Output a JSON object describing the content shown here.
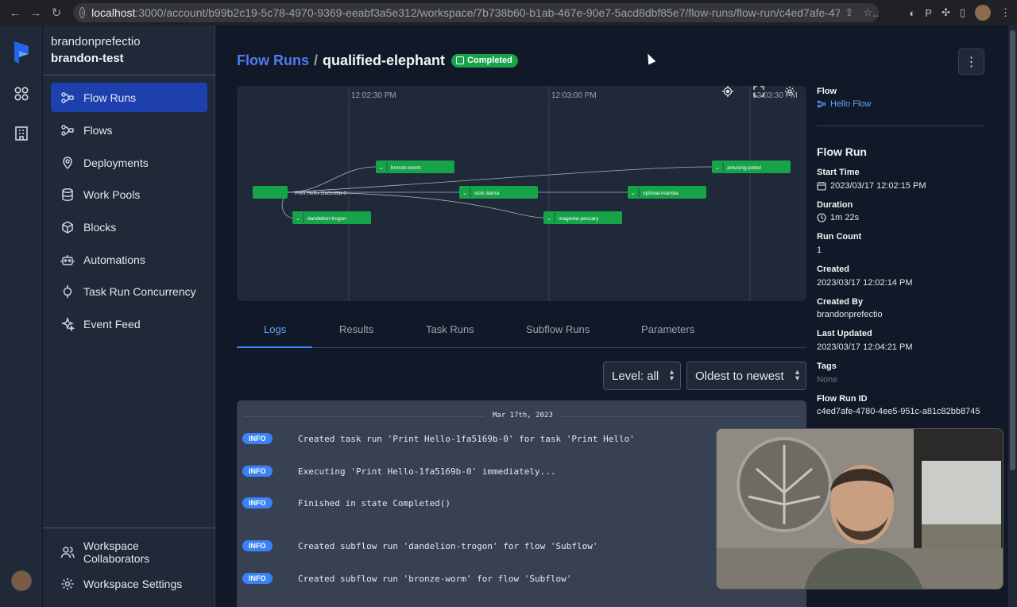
{
  "browser": {
    "url_host": "localhost",
    "url_rest": ":3000/account/b99b2c19-5c78-4970-9369-eeabf3a5e312/workspace/7b738b60-b1ab-467e-90e7-5acd8dbf85e7/flow-runs/flow-run/c4ed7afe-4780-4e..."
  },
  "account": {
    "name": "brandonprefectio",
    "workspace": "brandon-test"
  },
  "sidebar": {
    "items": [
      {
        "label": "Flow Runs",
        "icon": "flow-runs-icon"
      },
      {
        "label": "Flows",
        "icon": "flows-icon"
      },
      {
        "label": "Deployments",
        "icon": "deployments-icon"
      },
      {
        "label": "Work Pools",
        "icon": "work-pools-icon"
      },
      {
        "label": "Blocks",
        "icon": "blocks-icon"
      },
      {
        "label": "Automations",
        "icon": "automations-icon"
      },
      {
        "label": "Task Run Concurrency",
        "icon": "concurrency-icon"
      },
      {
        "label": "Event Feed",
        "icon": "event-feed-icon"
      }
    ],
    "footer": [
      {
        "label": "Workspace Collaborators",
        "icon": "collaborators-icon"
      },
      {
        "label": "Workspace Settings",
        "icon": "settings-icon"
      }
    ]
  },
  "header": {
    "breadcrumb_link": "Flow Runs",
    "separator": "/",
    "run_name": "qualified-elephant",
    "state": "Completed"
  },
  "graph": {
    "times": [
      "12:02:30 PM",
      "12:03:00 PM",
      "12:03:30 PM"
    ],
    "root_label": "Print Hello-1fa5169b-0",
    "nodes": [
      "bronze-worm",
      "amusing-petrel",
      "stoic-llama",
      "optimal-mamba",
      "dandelion-trogon",
      "magenta-peccary"
    ]
  },
  "tabs": [
    "Logs",
    "Results",
    "Task Runs",
    "Subflow Runs",
    "Parameters"
  ],
  "filters": {
    "level": "Level: all",
    "order": "Oldest to newest"
  },
  "logs": {
    "date": "Mar 17th, 2023",
    "rows": [
      {
        "level": "INFO",
        "message": "Created task run 'Print Hello-1fa5169b-0' for task 'Print Hello'"
      },
      {
        "level": "INFO",
        "message": "Executing 'Print Hello-1fa5169b-0' immediately..."
      },
      {
        "level": "INFO",
        "message": "Finished in state Completed()"
      },
      {
        "level": "INFO",
        "message": "Created subflow run 'dandelion-trogon' for flow 'Subflow'"
      },
      {
        "level": "INFO",
        "message": "Created subflow run 'bronze-worm' for flow 'Subflow'"
      }
    ]
  },
  "details": {
    "flow_label": "Flow",
    "flow_value": "Hello Flow",
    "section": "Flow Run",
    "start_time_label": "Start Time",
    "start_time": "2023/03/17 12:02:15 PM",
    "duration_label": "Duration",
    "duration": "1m 22s",
    "run_count_label": "Run Count",
    "run_count": "1",
    "created_label": "Created",
    "created": "2023/03/17 12:02:14 PM",
    "created_by_label": "Created By",
    "created_by": "brandonprefectio",
    "updated_label": "Last Updated",
    "updated": "2023/03/17 12:04:21 PM",
    "tags_label": "Tags",
    "tags": "None",
    "id_label": "Flow Run ID",
    "id": "c4ed7afe-4780-4ee5-951c-a81c82bb8745"
  },
  "colors": {
    "accent": "#1e40af",
    "success": "#16a34a",
    "link": "#4f7cf3",
    "info": "#3b82f6"
  }
}
